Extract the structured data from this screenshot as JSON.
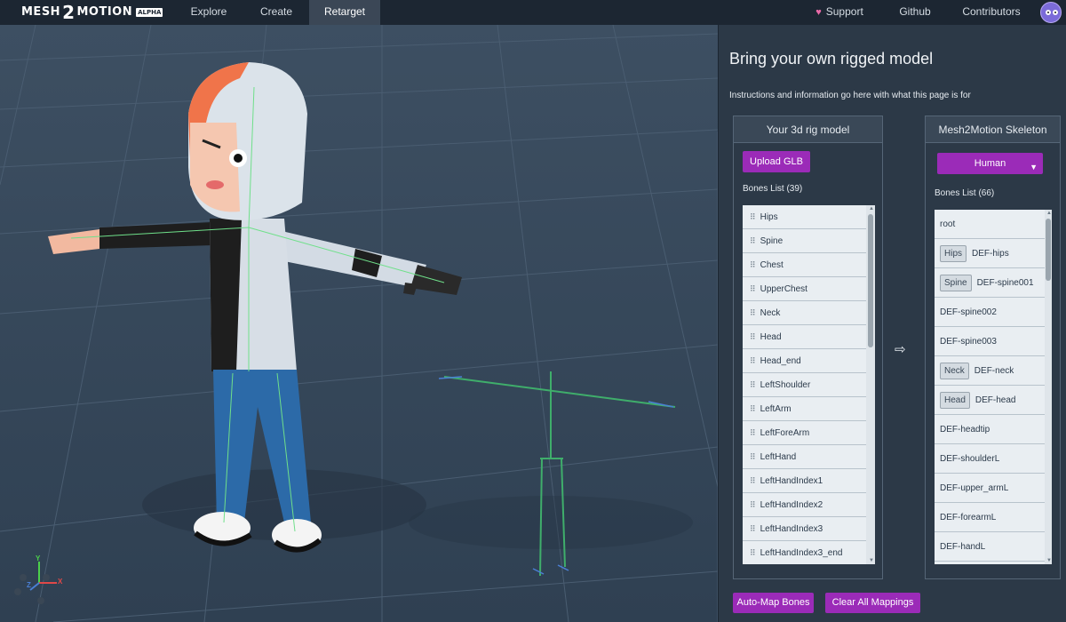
{
  "nav": {
    "logo_left": "MESH",
    "logo_num": "2",
    "logo_right": "MOTION",
    "logo_badge": "ALPHA",
    "explore": "Explore",
    "create": "Create",
    "retarget": "Retarget",
    "support": "Support",
    "github": "Github",
    "contributors": "Contributors"
  },
  "viewport": {
    "axis_labels": {
      "y": "Y",
      "z": "Z",
      "x": "X"
    }
  },
  "panel": {
    "title": "Bring your own rigged model",
    "description": "Instructions and information go here with what this page is for",
    "left": {
      "header": "Your 3d rig model",
      "upload_label": "Upload GLB",
      "bones_label": "Bones List (39)",
      "bones": [
        "Hips",
        "Spine",
        "Chest",
        "UpperChest",
        "Neck",
        "Head",
        "Head_end",
        "LeftShoulder",
        "LeftArm",
        "LeftForeArm",
        "LeftHand",
        "LeftHandIndex1",
        "LeftHandIndex2",
        "LeftHandIndex3",
        "LeftHandIndex3_end"
      ]
    },
    "right": {
      "header": "Mesh2Motion Skeleton",
      "select_value": "Human",
      "bones_label": "Bones List (66)",
      "bones": [
        {
          "mapped": "",
          "name": "root"
        },
        {
          "mapped": "Hips",
          "name": "DEF-hips"
        },
        {
          "mapped": "Spine",
          "name": "DEF-spine001"
        },
        {
          "mapped": "",
          "name": "DEF-spine002"
        },
        {
          "mapped": "",
          "name": "DEF-spine003"
        },
        {
          "mapped": "Neck",
          "name": "DEF-neck"
        },
        {
          "mapped": "Head",
          "name": "DEF-head"
        },
        {
          "mapped": "",
          "name": "DEF-headtip"
        },
        {
          "mapped": "",
          "name": "DEF-shoulderL"
        },
        {
          "mapped": "",
          "name": "DEF-upper_armL"
        },
        {
          "mapped": "",
          "name": "DEF-forearmL"
        },
        {
          "mapped": "",
          "name": "DEF-handL"
        }
      ]
    },
    "arrow": "⇨",
    "auto_map": "Auto-Map Bones",
    "clear_all": "Clear All Mappings"
  },
  "colors": {
    "accent": "#9b2bb8",
    "topbar": "#1c2632",
    "panel": "#2c3947",
    "viewport": "#35475a"
  }
}
